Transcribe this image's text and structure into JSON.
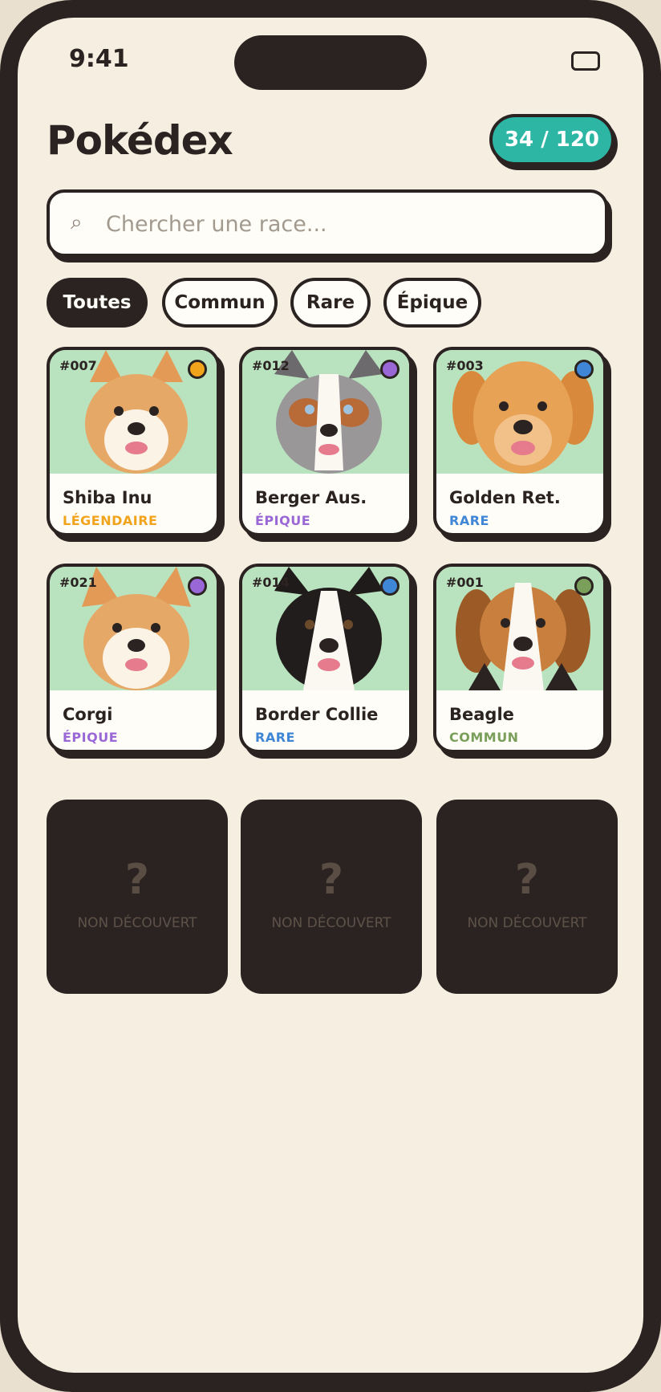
{
  "status_bar": {
    "time": "9:41"
  },
  "header": {
    "title": "Pokédex",
    "counter": "34 / 120"
  },
  "search": {
    "placeholder": "Chercher une race...",
    "value": ""
  },
  "filters": [
    "Toutes",
    "Commun",
    "Rare",
    "Épique"
  ],
  "active_filter": "Toutes",
  "cards": [
    {
      "number": "#007",
      "name": "Shiba Inu",
      "rarity": "LÉGENDAIRE",
      "color": "#f2a31c"
    },
    {
      "number": "#012",
      "name": "Berger Aus.",
      "rarity": "ÉPIQUE",
      "color": "#9a67d6"
    },
    {
      "number": "#003",
      "name": "Golden Ret.",
      "rarity": "RARE",
      "color": "#3f86d6"
    },
    {
      "number": "#021",
      "name": "Corgi",
      "rarity": "ÉPIQUE",
      "color": "#9a67d6"
    },
    {
      "number": "#014",
      "name": "Border Collie",
      "rarity": "RARE",
      "color": "#3f86d6"
    },
    {
      "number": "#001",
      "name": "Beagle",
      "rarity": "COMMUN",
      "color": "#7a9f5a"
    }
  ],
  "locked": [
    {
      "symbol": "?",
      "label": "NON DÉCOUVERT"
    },
    {
      "symbol": "?",
      "label": "NON DÉCOUVERT"
    },
    {
      "symbol": "?",
      "label": "NON DÉCOUVERT"
    }
  ],
  "icons": {
    "search": "search-icon",
    "battery": "battery-icon"
  }
}
